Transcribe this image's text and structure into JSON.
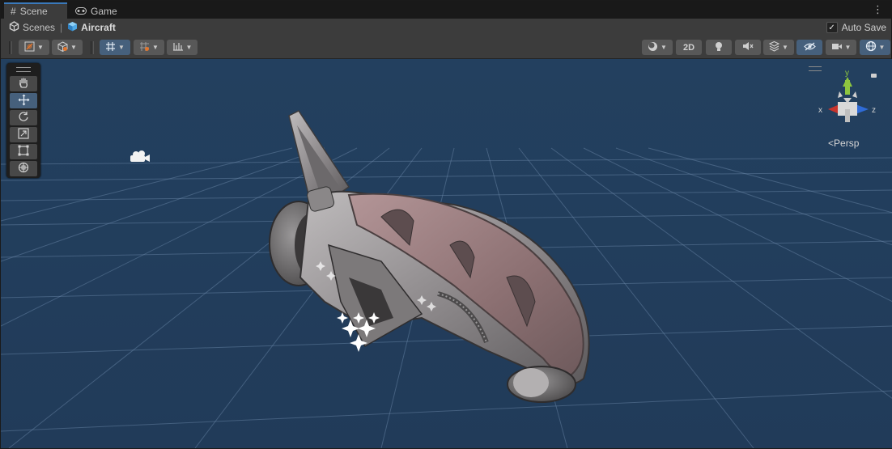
{
  "tabs": [
    {
      "label": "Scene",
      "icon": "grid-hash-icon",
      "active": true
    },
    {
      "label": "Game",
      "icon": "gamepad-icon",
      "active": false
    }
  ],
  "breadcrumb": [
    {
      "label": "Scenes",
      "icon": "unity-logo-icon"
    },
    {
      "label": "Aircraft",
      "icon": "cube-prefab-icon"
    }
  ],
  "autosave": {
    "label": "Auto Save",
    "checked": true
  },
  "toolbar": {
    "view_2d_label": "2D"
  },
  "viewport": {
    "persp_label": "Persp",
    "gizmo": {
      "x_label": "x",
      "y_label": "y",
      "z_label": "z"
    },
    "background_color": "#233e5f"
  },
  "tools": [
    {
      "name": "hand-tool",
      "icon": "hand-icon",
      "active": false
    },
    {
      "name": "move-tool",
      "icon": "move-arrows-icon",
      "active": true
    },
    {
      "name": "rotate-tool",
      "icon": "rotate-icon",
      "active": false
    },
    {
      "name": "scale-tool",
      "icon": "scale-icon",
      "active": false
    },
    {
      "name": "rect-tool",
      "icon": "rect-icon",
      "active": false
    },
    {
      "name": "transform-tool",
      "icon": "transform-globe-icon",
      "active": false
    }
  ],
  "colors": {
    "accent": "#3a79bb",
    "axis_x": "#c8342c",
    "axis_y": "#8ec63f",
    "axis_z": "#2f6bd6"
  }
}
